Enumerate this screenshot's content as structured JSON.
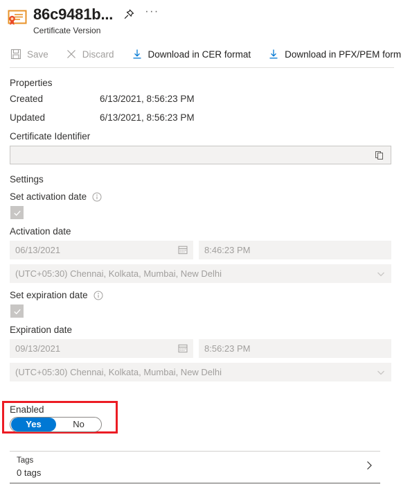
{
  "header": {
    "icon": "certificate-icon",
    "title": "86c9481b...",
    "subtitle": "Certificate Version",
    "pin_icon": "pin-icon",
    "more_icon": "ellipsis-icon",
    "more_label": "···"
  },
  "commandbar": {
    "items": [
      {
        "label": "Save",
        "icon": "save-icon",
        "enabled": false
      },
      {
        "label": "Discard",
        "icon": "discard-icon",
        "enabled": false
      },
      {
        "label": "Download in CER format",
        "icon": "download-icon",
        "enabled": true
      },
      {
        "label": "Download in PFX/PEM format",
        "icon": "download-icon",
        "enabled": true
      }
    ],
    "save_label": "Save",
    "discard_label": "Discard",
    "download_cer_label": "Download in CER format",
    "download_pfx_label": "Download in PFX/PEM format"
  },
  "properties": {
    "heading": "Properties",
    "created_label": "Created",
    "created_value": "6/13/2021, 8:56:23 PM",
    "updated_label": "Updated",
    "updated_value": "6/13/2021, 8:56:23 PM",
    "identifier_label": "Certificate Identifier",
    "identifier_value": "",
    "copy_icon": "copy-icon"
  },
  "settings": {
    "heading": "Settings",
    "activation": {
      "toggle_label": "Set activation date",
      "info_icon": "info-icon",
      "checked": true,
      "date_label": "Activation date",
      "date_value": "06/13/2021",
      "time_value": "8:46:23 PM",
      "timezone_value": "(UTC+05:30) Chennai, Kolkata, Mumbai, New Delhi",
      "calendar_icon": "calendar-icon",
      "chevron_icon": "chevron-down-icon"
    },
    "expiration": {
      "toggle_label": "Set expiration date",
      "info_icon": "info-icon",
      "checked": true,
      "date_label": "Expiration date",
      "date_value": "09/13/2021",
      "time_value": "8:56:23 PM",
      "timezone_value": "(UTC+05:30) Chennai, Kolkata, Mumbai, New Delhi",
      "calendar_icon": "calendar-icon",
      "chevron_icon": "chevron-down-icon"
    },
    "enabled": {
      "label": "Enabled",
      "yes_label": "Yes",
      "no_label": "No",
      "value": "Yes",
      "highlight_color": "#ec1c24",
      "accent_color": "#0078d4"
    }
  },
  "tags": {
    "title": "Tags",
    "count_label": "0 tags",
    "chevron_icon": "chevron-right-icon"
  }
}
